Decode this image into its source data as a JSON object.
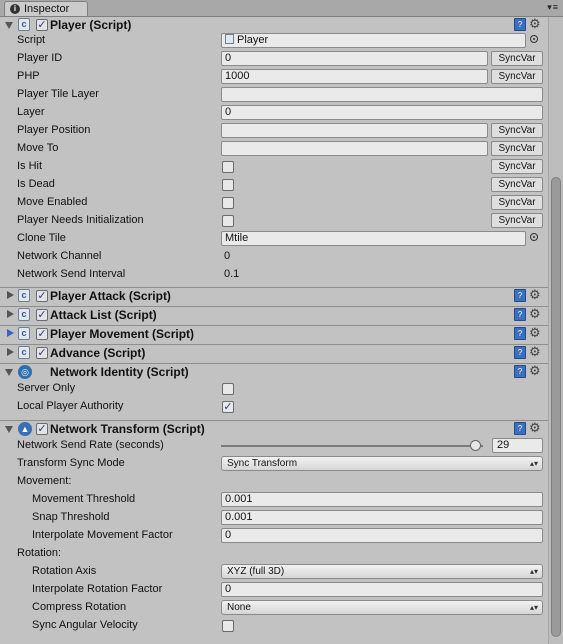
{
  "tab": {
    "title": "Inspector"
  },
  "player_script": {
    "title": "Player (Script)",
    "script_value": "Player",
    "sync_label": "SyncVar",
    "fields": {
      "script": "Script",
      "player_id": "Player ID",
      "player_id_value": "0",
      "php": "PHP",
      "php_value": "1000",
      "player_tile_layer": "Player Tile Layer",
      "player_tile_layer_value": "",
      "layer": "Layer",
      "layer_value": "0",
      "player_position": "Player Position",
      "player_position_value": "",
      "move_to": "Move To",
      "move_to_value": "",
      "is_hit": "Is Hit",
      "is_hit_checked": false,
      "is_dead": "Is Dead",
      "is_dead_checked": false,
      "move_enabled": "Move Enabled",
      "move_enabled_checked": false,
      "player_needs_init": "Player Needs Initialization",
      "player_needs_init_checked": false,
      "clone_tile": "Clone Tile",
      "clone_tile_value": "Mtile",
      "network_channel": "Network Channel",
      "network_channel_value": "0",
      "network_send_interval": "Network Send Interval",
      "network_send_interval_value": "0.1"
    }
  },
  "components": [
    {
      "title": "Player Attack (Script)",
      "expanded": false
    },
    {
      "title": "Attack List (Script)",
      "expanded": false
    },
    {
      "title": "Player Movement (Script)",
      "expanded": false
    },
    {
      "title": "Advance (Script)",
      "expanded": false
    }
  ],
  "network_identity": {
    "title": "Network Identity (Script)",
    "server_only": "Server Only",
    "server_only_checked": false,
    "local_player_authority": "Local Player Authority",
    "local_player_authority_checked": true
  },
  "network_transform": {
    "title": "Network Transform (Script)",
    "send_rate_label": "Network Send Rate (seconds)",
    "send_rate_value": "29",
    "send_rate_fraction": 0.97,
    "sync_mode_label": "Transform Sync Mode",
    "sync_mode_value": "Sync Transform",
    "movement_header": "Movement:",
    "movement_threshold_label": "Movement Threshold",
    "movement_threshold_value": "0.001",
    "snap_threshold_label": "Snap Threshold",
    "snap_threshold_value": "0.001",
    "interp_movement_label": "Interpolate Movement Factor",
    "interp_movement_value": "0",
    "rotation_header": "Rotation:",
    "rotation_axis_label": "Rotation Axis",
    "rotation_axis_value": "XYZ (full 3D)",
    "interp_rotation_label": "Interpolate Rotation Factor",
    "interp_rotation_value": "0",
    "compress_rotation_label": "Compress Rotation",
    "compress_rotation_value": "None",
    "sync_angular_label": "Sync Angular Velocity",
    "sync_angular_checked": false
  }
}
